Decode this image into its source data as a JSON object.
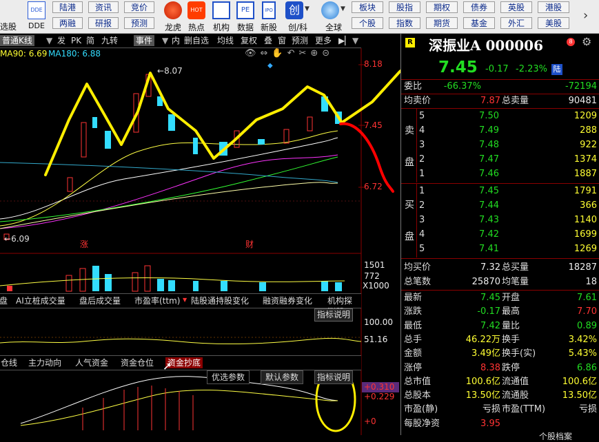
{
  "toolbar": {
    "left_labels": [
      "选股",
      "DDE"
    ],
    "top_row": [
      "陆港",
      "资讯",
      "竞价"
    ],
    "bottom_row": [
      "两融",
      "研报",
      "预测"
    ],
    "icon_labels": [
      "龙虎",
      "热点",
      "机构",
      "数据",
      "新股",
      "创/科",
      "全球"
    ],
    "right_top": [
      "板块",
      "股指",
      "期权",
      "债券",
      "英股",
      "港股"
    ],
    "right_bottom": [
      "个股",
      "指数",
      "期货",
      "基金",
      "外汇",
      "美股"
    ],
    "icon_badges": {
      "ddes": "DDE",
      "pe": "PE",
      "ipo": "IPO",
      "hot": "HOT"
    }
  },
  "chart_toolbar": {
    "items": [
      "普通K线",
      "发",
      "PK",
      "简",
      "九转",
      "事件",
      "内",
      "删自选",
      "均线",
      "复权",
      "叠",
      "窗",
      "预测",
      "更多"
    ],
    "ma_labels": [
      {
        "text": "MA90: 6.69",
        "color": "#ffff33"
      },
      {
        "text": "MA180: 6.88",
        "color": "#33ddff"
      }
    ]
  },
  "kline": {
    "price_labels": [
      "8.18",
      "7.45",
      "6.72"
    ],
    "high_label": "8.07",
    "low_label": "6.09",
    "markers": [
      "涨",
      "财"
    ]
  },
  "volume": {
    "labels": [
      "1501",
      "772",
      "X1000"
    ]
  },
  "indicator_tabs": {
    "items": [
      "盘",
      "AI立桩成交量",
      "盘后成交量",
      "市盈率(ttm)",
      "陆股通持股变化",
      "融资融券变化",
      "机构探测器"
    ],
    "explain": "指标说明",
    "labels": [
      "100.00",
      "51.16"
    ]
  },
  "fund_tabs": {
    "items": [
      "仓线",
      "主力动向",
      "人气资金",
      "资金仓位",
      "资金抄底"
    ],
    "selected": "资金抄底",
    "buttons": [
      "优选参数",
      "默认参数",
      "指标说明"
    ],
    "labels": [
      "+0.310",
      "+0.229",
      "+0"
    ]
  },
  "quote": {
    "stock_name": "深振业A",
    "stock_code": "000006",
    "price": "7.45",
    "change": "-0.17",
    "change_pct": "-2.23%",
    "market_badge": "陆",
    "r_badge": "R",
    "weibi_label": "委比",
    "weibi_value": "-66.37%",
    "weicha_value": "-72194",
    "avg_sell_label": "均卖价",
    "avg_sell_value": "7.87",
    "total_sell_label": "总卖量",
    "total_sell_value": "90481",
    "sell_side_label": [
      "卖",
      "盘"
    ],
    "buy_side_label": [
      "买",
      "盘"
    ],
    "sell_levels": [
      {
        "level": "5",
        "price": "7.50",
        "vol": "1209"
      },
      {
        "level": "4",
        "price": "7.49",
        "vol": "288"
      },
      {
        "level": "3",
        "price": "7.48",
        "vol": "922"
      },
      {
        "level": "2",
        "price": "7.47",
        "vol": "1374"
      },
      {
        "level": "1",
        "price": "7.46",
        "vol": "1887"
      }
    ],
    "buy_levels": [
      {
        "level": "1",
        "price": "7.45",
        "vol": "1791"
      },
      {
        "level": "2",
        "price": "7.44",
        "vol": "366"
      },
      {
        "level": "3",
        "price": "7.43",
        "vol": "1140"
      },
      {
        "level": "4",
        "price": "7.42",
        "vol": "1699"
      },
      {
        "level": "5",
        "price": "7.41",
        "vol": "1269"
      }
    ],
    "avg_buy_label": "均买价",
    "avg_buy_value": "7.32",
    "total_buy_label": "总买量",
    "total_buy_value": "18287",
    "trades_label": "总笔数",
    "trades_value": "25870",
    "avg_trade_label": "均笔量",
    "avg_trade_value": "18",
    "stats": [
      {
        "l1": "最新",
        "v1": "7.45",
        "c1": "grn",
        "l2": "开盘",
        "v2": "7.61",
        "c2": "grn"
      },
      {
        "l1": "涨跌",
        "v1": "-0.17",
        "c1": "grn",
        "l2": "最高",
        "v2": "7.70",
        "c2": "red"
      },
      {
        "l1": "最低",
        "v1": "7.42",
        "c1": "grn",
        "l2": "量比",
        "v2": "0.89",
        "c2": "grn"
      },
      {
        "l1": "总手",
        "v1": "46.22万",
        "c1": "yel",
        "l2": "换手",
        "v2": "3.42%",
        "c2": "yel"
      },
      {
        "l1": "金额",
        "v1": "3.49亿",
        "c1": "yel",
        "l2": "换手(实)",
        "v2": "5.43%",
        "c2": "yel"
      },
      {
        "l1": "涨停",
        "v1": "8.38",
        "c1": "red",
        "l2": "跌停",
        "v2": "6.86",
        "c2": "grn"
      },
      {
        "l1": "总市值",
        "v1": "100.6亿",
        "c1": "yel",
        "l2": "流通值",
        "v2": "100.6亿",
        "c2": "yel"
      },
      {
        "l1": "总股本",
        "v1": "13.50亿",
        "c1": "yel",
        "l2": "流通股",
        "v2": "13.50亿",
        "c2": "yel"
      },
      {
        "l1": "市盈(静)",
        "v1": "亏损",
        "c1": "wht",
        "l2": "市盈(TTM)",
        "v2": "亏损",
        "c2": "wht"
      },
      {
        "l1": "每股净资",
        "v1": "3.95",
        "c1": "red",
        "l2": "",
        "v2": "",
        "c2": "wht"
      }
    ],
    "bottom_tab": "个股档案"
  },
  "colors": {
    "up": "#ff3333",
    "down": "#33ddff",
    "annotation_yellow": "#ffee00",
    "annotation_red": "#ff0000",
    "panel_divider": "#8b0000"
  }
}
